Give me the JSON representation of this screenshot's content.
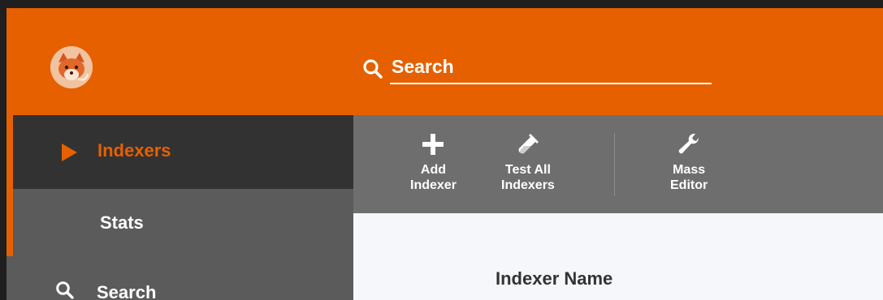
{
  "header": {
    "search_placeholder": "Search"
  },
  "sidebar": {
    "items": [
      {
        "label": "Indexers",
        "icon": "play-arrow-icon",
        "active": true
      },
      {
        "label": "Stats"
      },
      {
        "label": "Search",
        "icon": "search-icon"
      }
    ]
  },
  "toolbar": {
    "buttons": [
      {
        "line1": "Add",
        "line2": "Indexer",
        "icon": "plus-icon"
      },
      {
        "line1": "Test All",
        "line2": "Indexers",
        "icon": "test-tube-icon"
      },
      {
        "line1": "Mass",
        "line2": "Editor",
        "icon": "wrench-icon"
      }
    ]
  },
  "table": {
    "columns": [
      "Indexer Name"
    ]
  },
  "colors": {
    "accent": "#e66000",
    "sidebar": "#5b5b5b",
    "sidebar_active": "#323232",
    "toolbar": "#6e6e6e",
    "content": "#f5f7fa"
  }
}
